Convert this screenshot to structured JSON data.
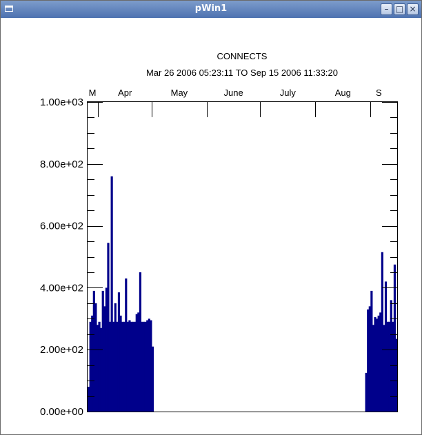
{
  "window": {
    "title": "pWin1",
    "minimize_glyph": "–",
    "maximize_glyph": "□",
    "close_glyph": "×",
    "menu_icon": "window-menu-icon",
    "minimize_icon": "minimize-icon",
    "maximize_icon": "maximize-icon",
    "close_icon": "close-icon"
  },
  "chart_data": {
    "type": "bar",
    "title": "CONNECTS",
    "subtitle": "Mar 26 2006 05:23:11 TO Sep 15 2006 11:33:20",
    "bar_color": "#00008b",
    "ylim": [
      0,
      1000
    ],
    "ytick_labels": [
      "0.00e+00",
      "2.00e+02",
      "4.00e+02",
      "6.00e+02",
      "8.00e+02",
      "1.00e+03"
    ],
    "ytick_values": [
      0,
      200,
      400,
      600,
      800,
      1000
    ],
    "xlim": [
      "2006-03-26",
      "2006-09-16"
    ],
    "month_labels": [
      "M",
      "Apr",
      "May",
      "June",
      "July",
      "Aug",
      "S"
    ],
    "month_starts": [
      "2006-04-01",
      "2006-05-01",
      "2006-06-01",
      "2006-07-01",
      "2006-08-01",
      "2006-09-01"
    ],
    "grid": false,
    "legend": "none",
    "series": [
      {
        "x": [
          "2006-03-26",
          "2006-03-27",
          "2006-03-28",
          "2006-03-29",
          "2006-03-30",
          "2006-03-31",
          "2006-04-01",
          "2006-04-02",
          "2006-04-03",
          "2006-04-04",
          "2006-04-05",
          "2006-04-06",
          "2006-04-07",
          "2006-04-08",
          "2006-04-09",
          "2006-04-10",
          "2006-04-11",
          "2006-04-12",
          "2006-04-13",
          "2006-04-14",
          "2006-04-15",
          "2006-04-16",
          "2006-04-17",
          "2006-04-18",
          "2006-04-19",
          "2006-04-20",
          "2006-04-21",
          "2006-04-22",
          "2006-04-23",
          "2006-04-24",
          "2006-04-25",
          "2006-04-26",
          "2006-04-27",
          "2006-04-28",
          "2006-04-29",
          "2006-04-30",
          "2006-05-01",
          "2006-05-02",
          "2006-05-03",
          "2006-08-29",
          "2006-08-30",
          "2006-08-31",
          "2006-09-01",
          "2006-09-02",
          "2006-09-03",
          "2006-09-04",
          "2006-09-05",
          "2006-09-06",
          "2006-09-07",
          "2006-09-08",
          "2006-09-09",
          "2006-09-10",
          "2006-09-11",
          "2006-09-12",
          "2006-09-13",
          "2006-09-14",
          "2006-09-15"
        ],
        "values": [
          80,
          290,
          310,
          390,
          350,
          280,
          290,
          270,
          390,
          340,
          400,
          545,
          290,
          760,
          290,
          350,
          290,
          385,
          310,
          290,
          290,
          430,
          290,
          295,
          290,
          290,
          290,
          315,
          320,
          450,
          290,
          290,
          290,
          295,
          300,
          295,
          210,
          0,
          0,
          125,
          330,
          340,
          390,
          280,
          305,
          300,
          310,
          320,
          515,
          280,
          420,
          290,
          290,
          360,
          290,
          475,
          235
        ]
      }
    ]
  }
}
